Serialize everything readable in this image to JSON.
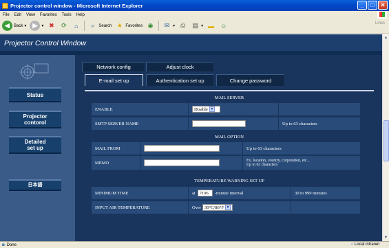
{
  "window": {
    "title": "Projector control window - Microsoft Internet Explorer",
    "buttons": [
      "_",
      "□",
      "✕"
    ]
  },
  "menubar": {
    "items": [
      "File",
      "Edit",
      "View",
      "Favorites",
      "Tools",
      "Help"
    ]
  },
  "toolbar": {
    "back_label": "Back",
    "search_label": "Search",
    "favorites_label": "Favorites",
    "links_label": "Links"
  },
  "page": {
    "header_title": "Projector Control Window",
    "sidebar": {
      "buttons": [
        "Status",
        "Projector\ncontorol",
        "Detailed\nset up",
        "日本語"
      ]
    },
    "tabs": {
      "top": [
        "Network config",
        "Adjust clock"
      ],
      "bottom": [
        "E-mail set up",
        "Authentication set up",
        "Change password"
      ]
    },
    "mail_server": {
      "title": "MAIL SERVER",
      "enable_label": "ENABLE",
      "enable_value": "Disable",
      "smtp_label": "SMTP SERVER NAME",
      "smtp_value": "",
      "smtp_hint": "Up to 63 characters"
    },
    "mail_option": {
      "title": "MAIL OPTION",
      "mail_from_label": "MAIL FROM",
      "mail_from_value": "",
      "mail_from_hint": "Up to 63 characters",
      "memo_label": "MEMO",
      "memo_value": "",
      "memo_hint_line1": "Ex. location, country, corporation, etc...",
      "memo_hint_line2": "Up to 63 characters"
    },
    "temperature": {
      "title": "TEMPERATURE WARNING SET UP",
      "min_time_label": "MINIMUM TIME",
      "min_time_prefix": "at",
      "min_time_value": "7196",
      "min_time_suffix": "-minute interval",
      "min_time_hint": "30 to 999 minutes",
      "air_label": "INPUT AIR TEMPERATURE",
      "air_prefix": "Over",
      "air_value": "30°C/86°F"
    }
  },
  "statusbar": {
    "left": "Done",
    "zone": "Local intranet"
  }
}
